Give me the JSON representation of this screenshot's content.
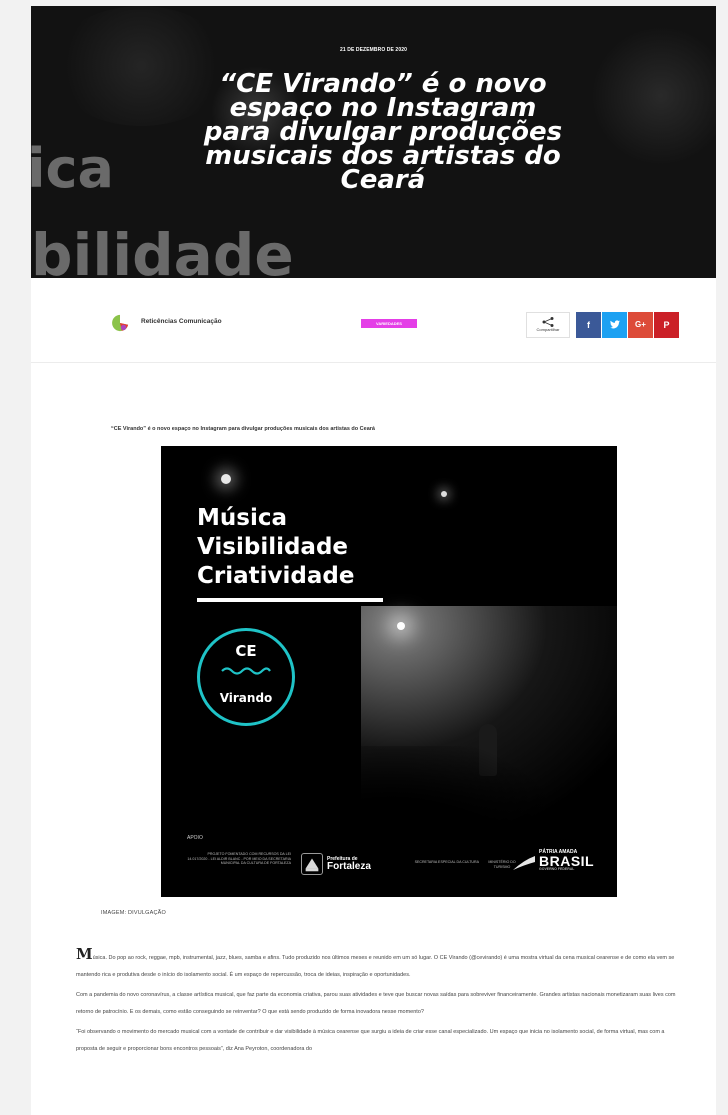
{
  "hero": {
    "date": "21 DE DEZEMBRO DE 2020",
    "title": "“CE Virando” é o novo espaço no Instagram para divulgar produções musicais dos artistas do Ceará",
    "background_words": [
      "ica",
      "bilidade"
    ]
  },
  "meta": {
    "author": "Reticências Comunicação",
    "category": "VARIEDADES",
    "share_label": "Compartilhar",
    "social": {
      "facebook": "f",
      "twitter": "",
      "google": "G+",
      "pinterest": "P"
    }
  },
  "article": {
    "headline": "“CE Virando” é o novo espaço no Instagram para divulgar produções musicais dos artistas do Ceará",
    "poster": {
      "lines": [
        "Música",
        "Visibilidade",
        "Criatividade"
      ],
      "logo_top": "CE",
      "logo_bottom": "Virando",
      "apoio": "APOIO",
      "credit": "PROJETO FOMENTADO COM RECURSOS DA LEI 14.017/2020 - LEI ALDIR BLANC - POR MEIO DA SECRETARIA MUNICIPAL DA CULTURA DE FORTALEZA",
      "prefeitura_pre": "Prefeitura de",
      "prefeitura_name": "Fortaleza",
      "secretaria": "SECRETARIA ESPECIAL DA CULTURA",
      "ministerio": "MINISTÉRIO DO TURISMO",
      "patria_pre": "PÁTRIA AMADA",
      "patria_name": "BRASIL",
      "patria_sub": "GOVERNO FEDERAL"
    },
    "caption": "IMAGEM: DIVULGAÇÃO",
    "dropcap": "M",
    "p1": "úsica. Do pop ao rock, reggae, mpb, instrumental, jazz, blues, samba e afins. Tudo produzido nos últimos meses e reunido em um só lugar. O CE Virando (@cevirando) é uma mostra virtual da cena musical cearense e de como ela vem se mantendo rica e produtiva desde o início do isolamento social. É um espaço de repercussão, troca de ideias, inspiração e oportunidades.",
    "p2": "Com a pandemia do novo coronavírus, a classe artística musical, que faz parte da economia criativa, parou suas atividades e teve que buscar novas saídas para sobreviver financeiramente. Grandes artistas nacionais monetizaram suas lives com retorno de patrocínio. E os demais, como estão conseguindo se reinventar? O que está sendo produzido de forma inovadora nesse momento?",
    "p3": "“Foi observando o movimento do mercado musical com a vontade de contribuir e dar visibilidade à música cearense que surgiu a ideia de criar esse canal especializado. Um espaço que inicia no isolamento social, de forma virtual, mas com a proposta de seguir e proporcionar bons encontros pessoais”, diz Ana Peyroton, coordenadora do"
  },
  "colors": {
    "category": "#e43ee7",
    "facebook": "#3b5998",
    "twitter": "#1da1f2",
    "google": "#dd4b39",
    "pinterest": "#cb2027",
    "logo_ring": "#1fc3c7"
  }
}
